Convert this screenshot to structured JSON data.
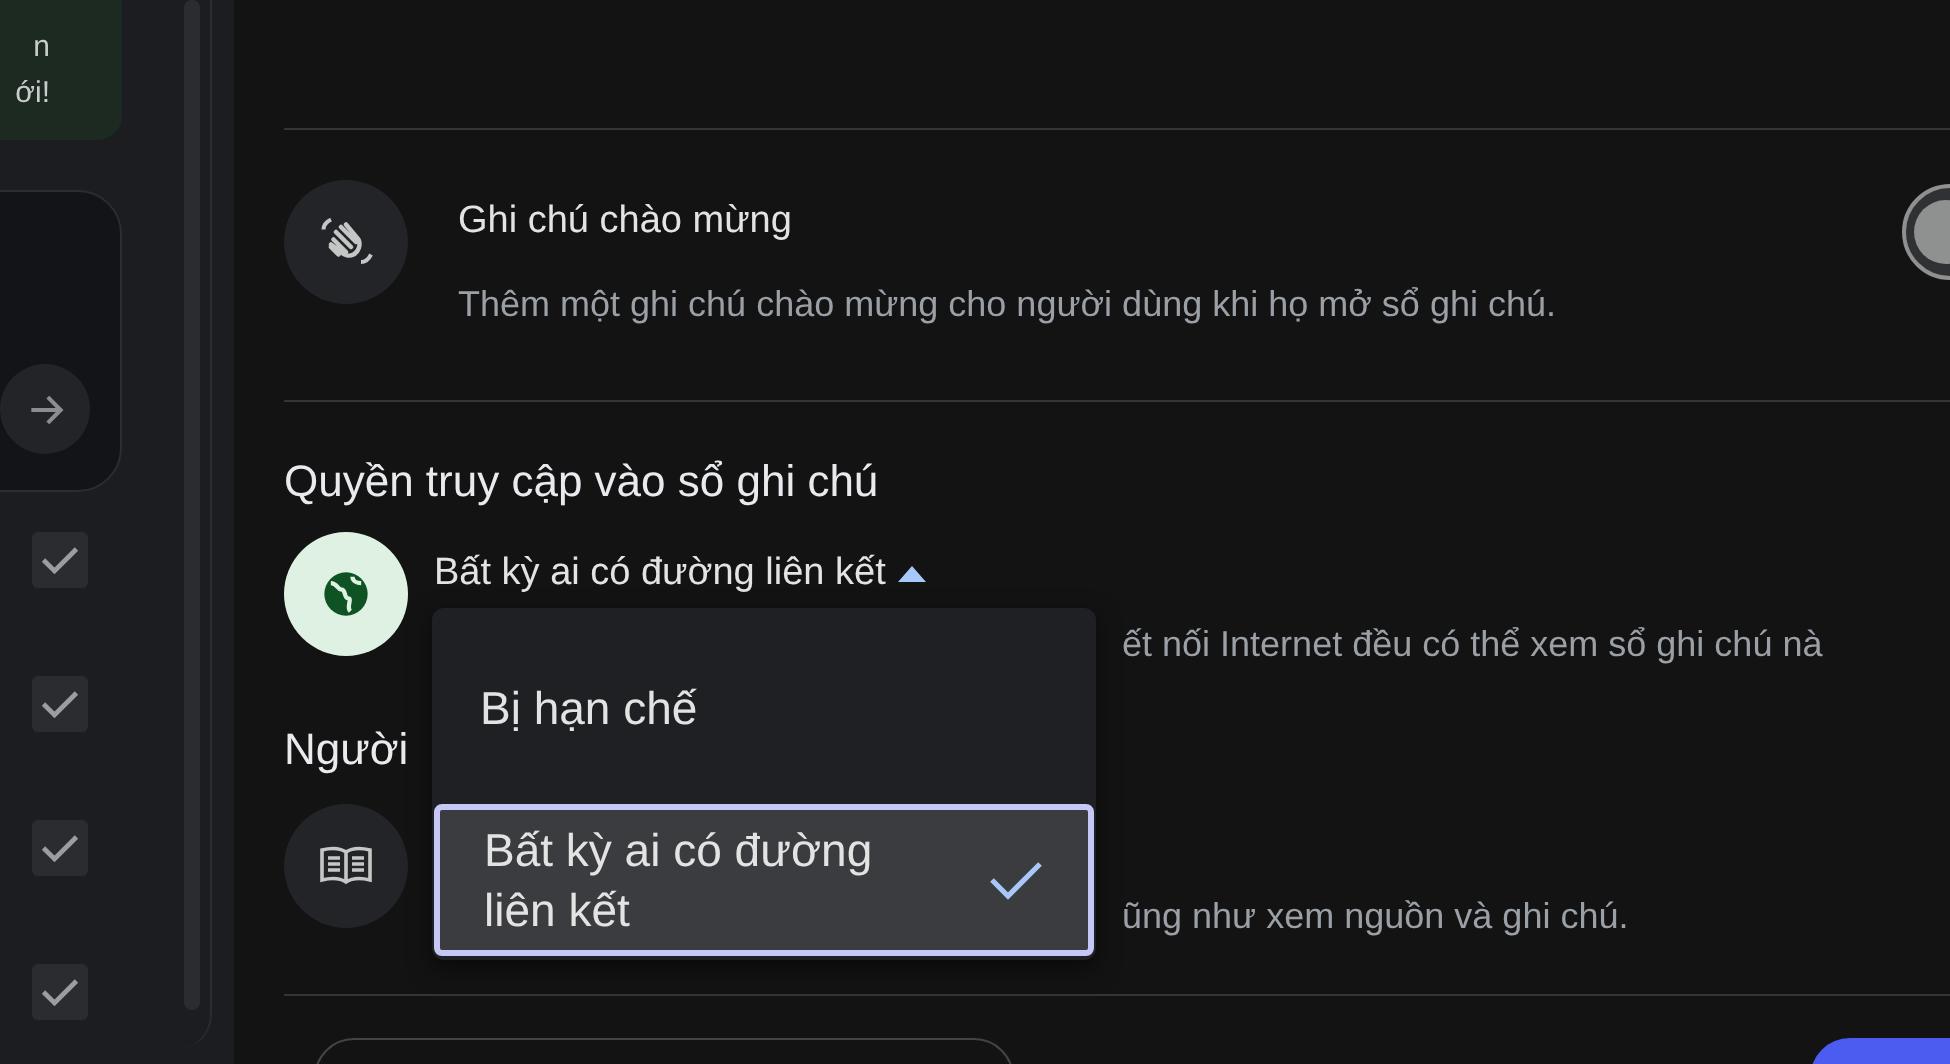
{
  "sidebar": {
    "banner_lines": [
      "n",
      "ới!"
    ],
    "checkboxes": [
      {
        "checked": true
      },
      {
        "checked": true
      },
      {
        "checked": true
      },
      {
        "checked": true
      }
    ]
  },
  "welcome_note": {
    "title": "Ghi chú chào mừng",
    "description": "Thêm một ghi chú chào mừng cho người dùng khi họ mở sổ ghi chú.",
    "toggle": {
      "on": false
    }
  },
  "access": {
    "heading": "Quyền truy cập vào sổ ghi chú",
    "dropdown": {
      "value": "Bất kỳ ai có đường liên kết",
      "expanded": true
    },
    "description": "ết nối Internet đều có thể xem sổ ghi chú nà"
  },
  "viewers": {
    "heading": "Người",
    "description": "ũng như xem nguồn và ghi chú."
  },
  "menu": {
    "options": [
      {
        "label": "Bị hạn chế",
        "selected": false
      },
      {
        "label": "Bất kỳ ai có đường liên kết",
        "selected": true
      }
    ]
  }
}
